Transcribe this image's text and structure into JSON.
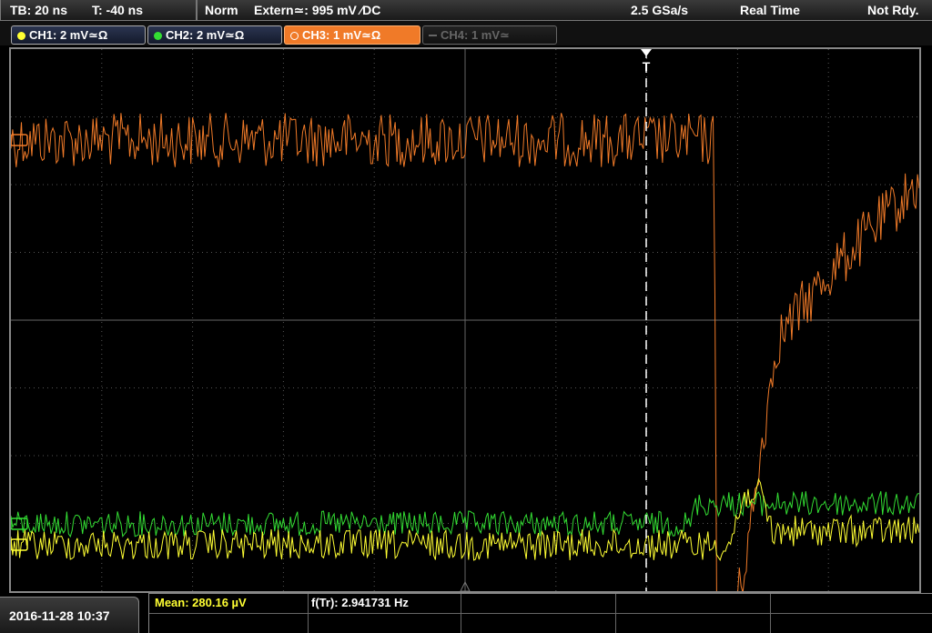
{
  "topbar": {
    "timebase": "TB: 20 ns",
    "trigger_time": "T: -40 ns",
    "trigger_mode": "Norm",
    "trigger_source": "Extern≃: 995 mV ∕DC",
    "sample_rate": "2.5 GSa/s",
    "acq_mode": "Real Time",
    "status": "Not Rdy."
  },
  "channels": [
    {
      "label": "CH1: 2 mV≃Ω",
      "color": "#ffff33",
      "state": "on"
    },
    {
      "label": "CH2: 2 mV≃Ω",
      "color": "#33dd33",
      "state": "on"
    },
    {
      "label": "CH3: 1 mV≃Ω",
      "color": "#f07a28",
      "state": "selected"
    },
    {
      "label": "CH4: 1 mV≃",
      "color": "#666666",
      "state": "off"
    }
  ],
  "trigger_marker": "T",
  "datetime": "2016-11-28 10:37",
  "measurements": {
    "mean": "Mean: 280.16 µV",
    "freq": "f(Tr): 2.941731 Hz"
  },
  "colors": {
    "ch1": "#ffff33",
    "ch2": "#33dd33",
    "ch3": "#f07a28",
    "grid": "#555555"
  }
}
